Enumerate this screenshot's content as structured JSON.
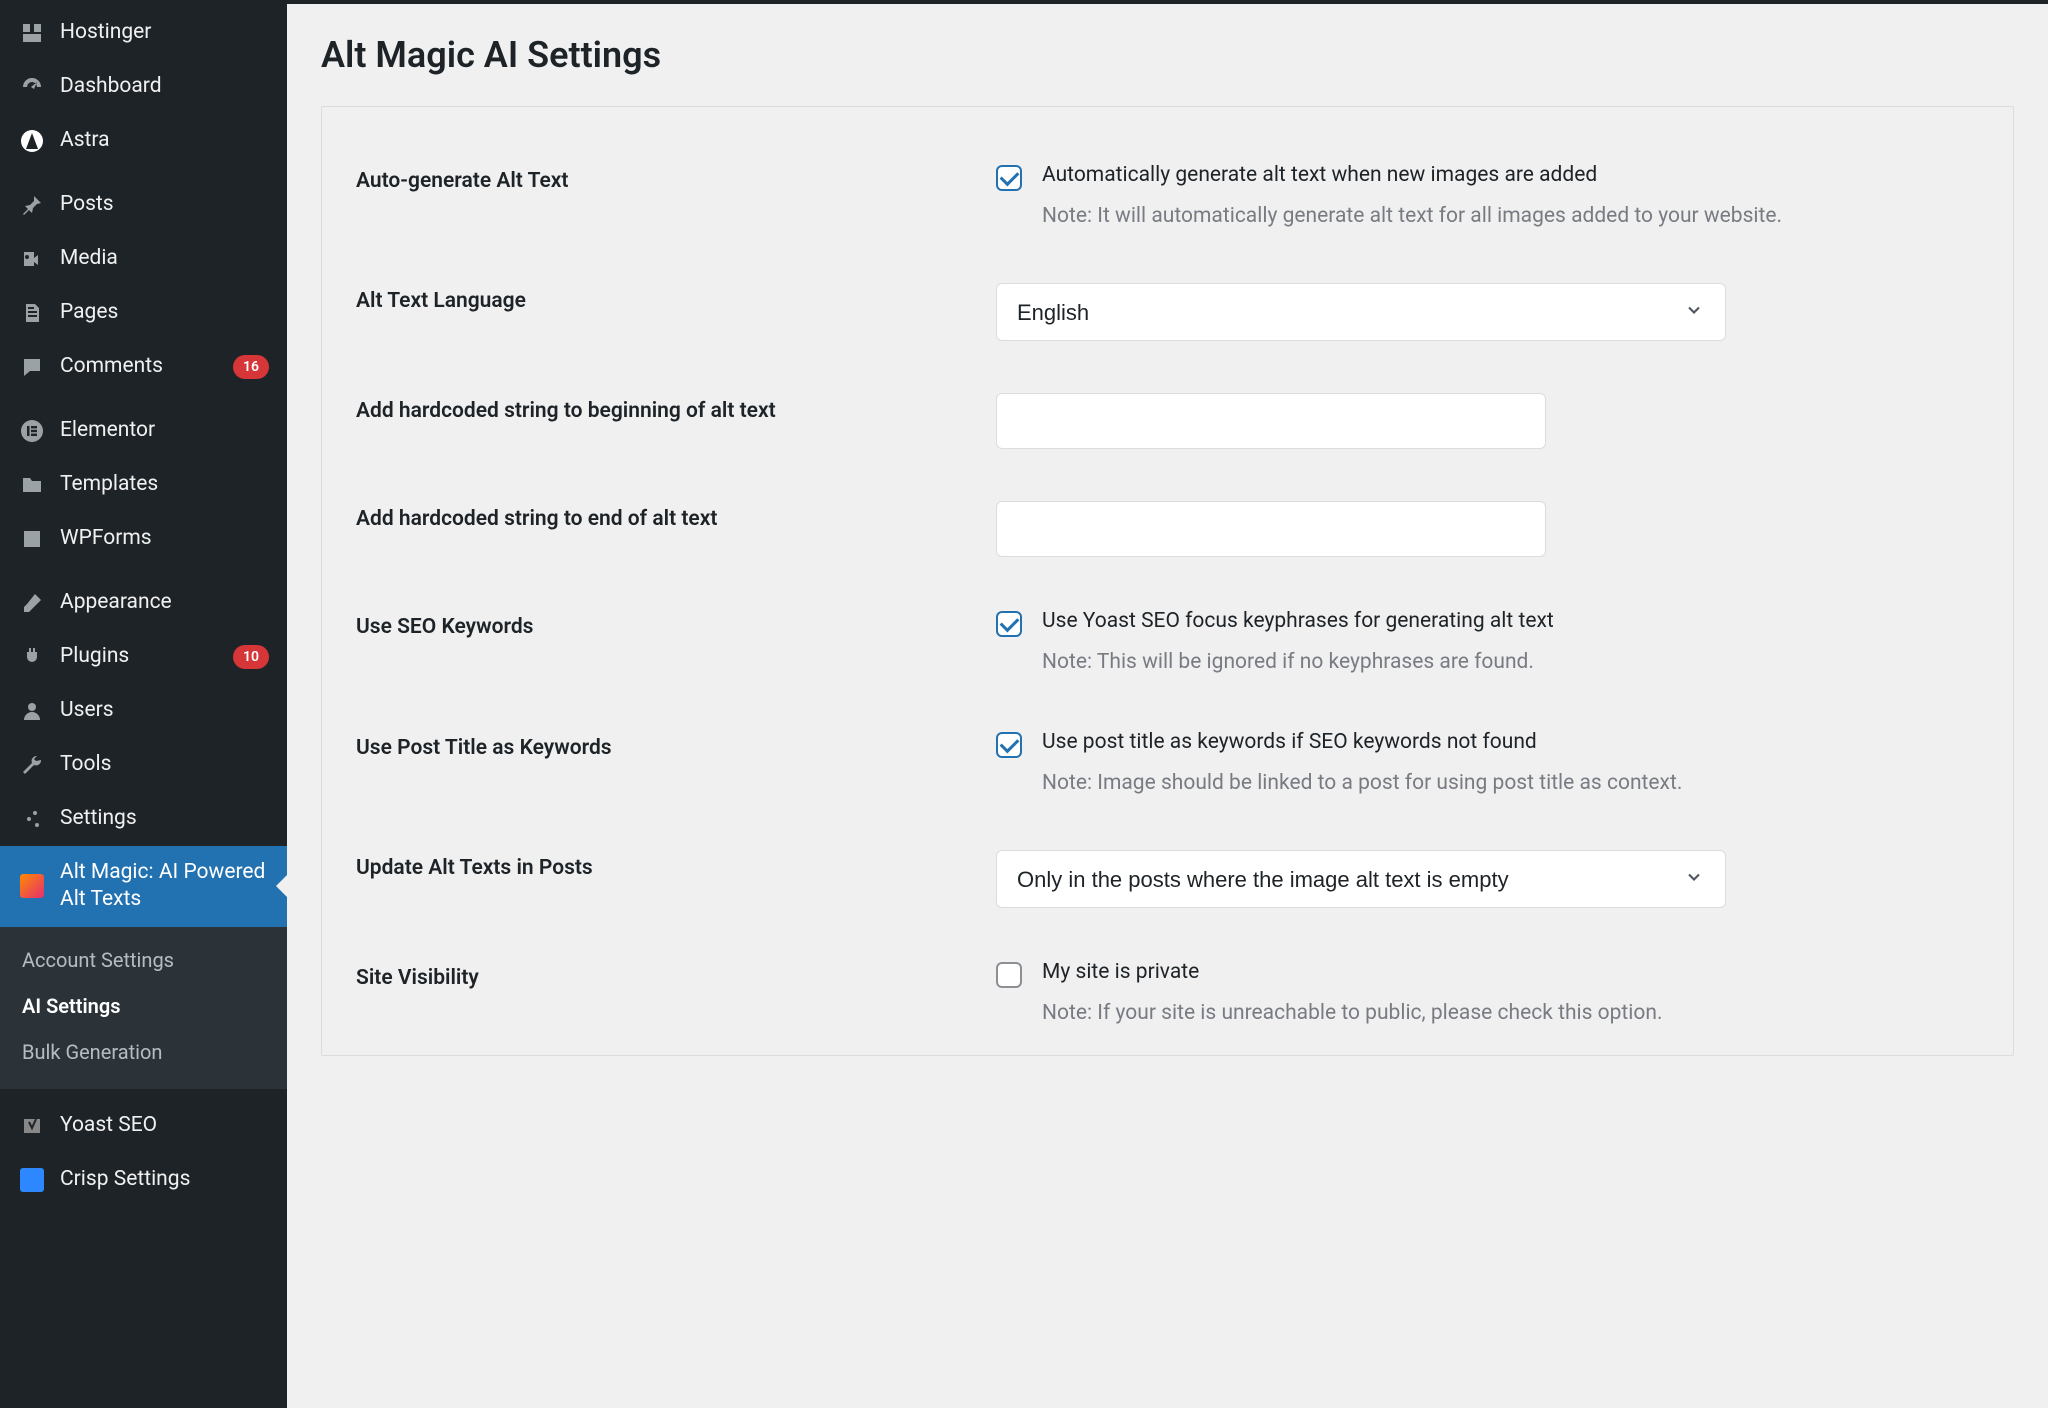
{
  "sidebar": {
    "items": [
      {
        "label": "Hostinger",
        "icon": "hostinger"
      },
      {
        "label": "Dashboard",
        "icon": "dashboard"
      },
      {
        "label": "Astra",
        "icon": "astra"
      }
    ],
    "items2": [
      {
        "label": "Posts",
        "icon": "pin"
      },
      {
        "label": "Media",
        "icon": "media"
      },
      {
        "label": "Pages",
        "icon": "pages"
      },
      {
        "label": "Comments",
        "icon": "comment",
        "badge": "16"
      }
    ],
    "items3": [
      {
        "label": "Elementor",
        "icon": "elementor"
      },
      {
        "label": "Templates",
        "icon": "folder"
      },
      {
        "label": "WPForms",
        "icon": "form"
      }
    ],
    "items4": [
      {
        "label": "Appearance",
        "icon": "brush"
      },
      {
        "label": "Plugins",
        "icon": "plug",
        "badge": "10"
      },
      {
        "label": "Users",
        "icon": "user"
      },
      {
        "label": "Tools",
        "icon": "wrench"
      },
      {
        "label": "Settings",
        "icon": "sliders"
      },
      {
        "label": "Alt Magic: AI Powered Alt Texts",
        "icon": "altmagic",
        "current": true
      }
    ],
    "submenu": [
      {
        "label": "Account Settings"
      },
      {
        "label": "AI Settings",
        "active": true
      },
      {
        "label": "Bulk Generation"
      }
    ],
    "items5": [
      {
        "label": "Yoast SEO",
        "icon": "yoast"
      },
      {
        "label": "Crisp Settings",
        "icon": "crisp"
      }
    ]
  },
  "page": {
    "title": "Alt Magic AI Settings"
  },
  "settings": {
    "auto_generate": {
      "label": "Auto-generate Alt Text",
      "checkbox_label": "Automatically generate alt text when new images are added",
      "note": "Note: It will automatically generate alt text for all images added to your website.",
      "checked": true
    },
    "language": {
      "label": "Alt Text Language",
      "value": "English"
    },
    "prefix": {
      "label": "Add hardcoded string to beginning of alt text",
      "value": ""
    },
    "suffix": {
      "label": "Add hardcoded string to end of alt text",
      "value": ""
    },
    "seo_keywords": {
      "label": "Use SEO Keywords",
      "checkbox_label": "Use Yoast SEO focus keyphrases for generating alt text",
      "note": "Note: This will be ignored if no keyphrases are found.",
      "checked": true
    },
    "post_title": {
      "label": "Use Post Title as Keywords",
      "checkbox_label": "Use post title as keywords if SEO keywords not found",
      "note": "Note: Image should be linked to a post for using post title as context.",
      "checked": true
    },
    "update_posts": {
      "label": "Update Alt Texts in Posts",
      "value": "Only in the posts where the image alt text is empty"
    },
    "site_visibility": {
      "label": "Site Visibility",
      "checkbox_label": "My site is private",
      "note": "Note: If your site is unreachable to public, please check this option.",
      "checked": false
    }
  }
}
